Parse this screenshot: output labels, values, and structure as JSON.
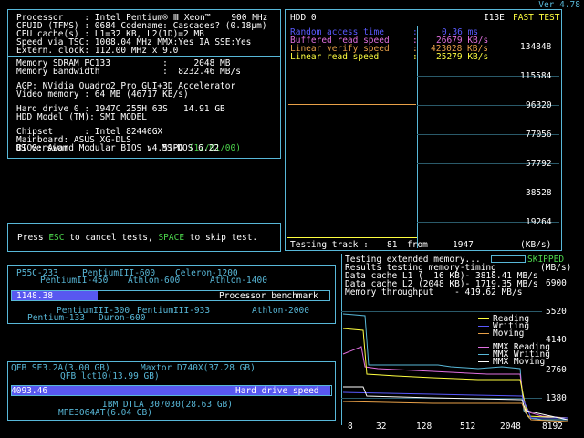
{
  "version": "Ver 4.78",
  "sysinfo": {
    "lines": [
      "Processor    : Intel Pentium® Ⅲ Xeon™    900 MHz",
      "CPUID (TFMS) : 0684 Codename: Cascades? (0.18µm)",
      "CPU cache(s) : L1=32 KB, L2(1D)=2 MB",
      "Speed via TSC: 1008.04 MHz MMX:Yes IA SSE:Yes",
      "Extern. clock: 112.00 MHz x 9.0",
      "Memory SDRAM PC133          :     2048 MB",
      "Memory Bandwidth            :  8232.46 MB/s",
      "AGP: NVidia Quadro2 Pro GUI+3D Accelerator",
      "Video memory : 64 MB (46717 KB/s)",
      "Hard drive 0 : 1947C 255H 63S   14.91 GB",
      "HDD Model (TM): SMI MODEL",
      "Chipset      : Intel 82440GX",
      "Mainboard: ASUS XG-DLS",
      "BIOS: Award Modular BIOS v4.51PG",
      "OS version               :  MS-DOS 6.22"
    ],
    "bios_date": " (12/01/00)"
  },
  "prompt": {
    "pre": "Press ",
    "esc": "ESC",
    "mid": " to cancel tests, ",
    "space": "SPACE",
    "post": " to skip test."
  },
  "hdd": {
    "title": "HDD 0",
    "mode": "I13E",
    "fast": "FAST TEST",
    "random_label": "Random access time",
    "random_value": "0.36 ms",
    "buffered_label": "Buffered read speed",
    "buffered_value": "26679 KB/s",
    "verify_label": "Linear verify speed",
    "verify_value": "423028 KB/s",
    "linear_label": "Linear read speed",
    "linear_value": "25279 KB/s",
    "yticks": [
      "134848",
      "115584",
      "96320",
      "77056",
      "57792",
      "38528",
      "19264"
    ],
    "track_label": "Testing track :",
    "track_cur": "81",
    "track_from": "from",
    "track_total": "1947",
    "unit": "(KB/s)"
  },
  "memtest": {
    "line1": "Testing extended memory...",
    "skipped": "SKIPPED",
    "line2": "Results testing memory-timing",
    "unit": "(MB/s)",
    "l1": "Data cache L1 (  16 KB)- 3818.41 MB/s",
    "l2": "Data cache L2 (2048 KB)- 1719.35 MB/s",
    "tp": "Memory throughput    - 419.62 MB/s",
    "yticks": [
      "6900",
      "5520",
      "4140",
      "2760",
      "1380"
    ],
    "xticks": [
      "8",
      "32",
      "128",
      "512",
      "2048",
      "8192"
    ],
    "legend": [
      "Reading",
      "Writing",
      "Moving",
      "MMX Reading",
      "MMX Writing",
      "MMX Moving"
    ],
    "colors": [
      "#ffff40",
      "#5a5aff",
      "#e8a048",
      "#e070e0",
      "#58b8d8",
      "#ffffff"
    ]
  },
  "cpu_bench": {
    "value": "1148.38",
    "label": "Processor benchmark",
    "refs_top": [
      "P55C-233",
      "PentiumIII-600",
      "Celeron-1200",
      "PentiumII-450",
      "Athlon-600",
      "Athlon-1400"
    ],
    "refs_bottom": [
      "PentiumIII-300",
      "PentiumIII-933",
      "Athlon-2000",
      "Pentium-133",
      "Duron-600"
    ],
    "fraction": 0.27
  },
  "hdd_bench": {
    "value": "4093.46",
    "label": "Hard drive speed",
    "refs_top": [
      "QFB SE3.2A(3.00 GB)",
      "Maxtor D740X(37.28 GB)",
      "QFB lct10(13.99 GB)"
    ],
    "refs_bottom": [
      "IBM DTLA 307030(28.63 GB)",
      "MPE3064AT(6.04 GB)"
    ],
    "fraction": 1.0
  }
}
